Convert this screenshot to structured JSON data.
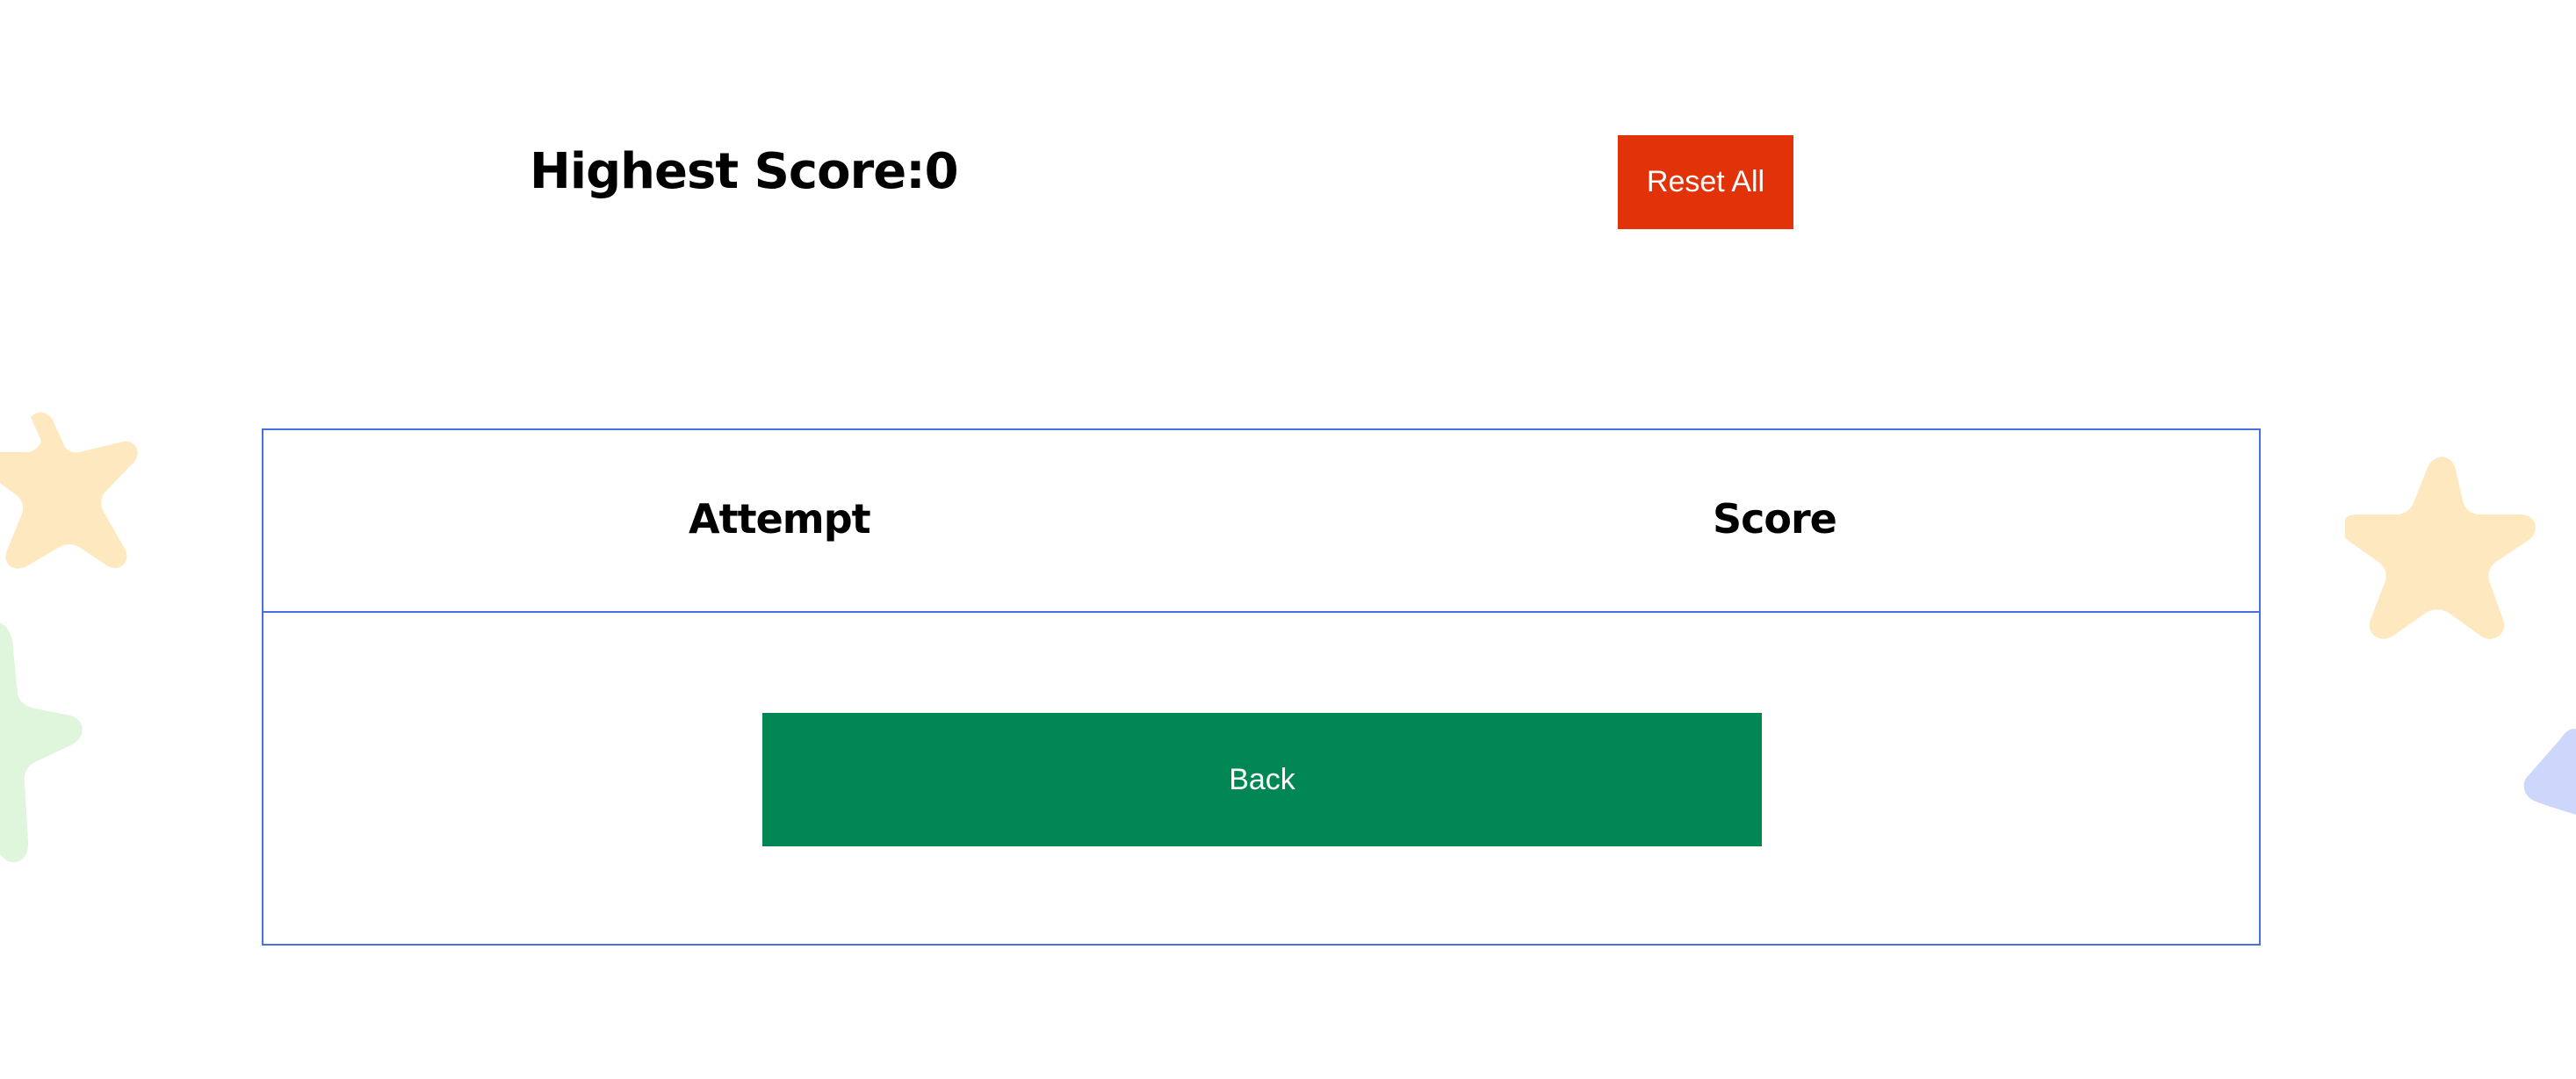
{
  "header": {
    "highest_score_label": "Highest Score:",
    "highest_score_value": "0",
    "reset_label": "Reset All"
  },
  "table": {
    "columns": [
      "Attempt",
      "Score"
    ],
    "rows": []
  },
  "actions": {
    "back_label": "Back"
  },
  "colors": {
    "reset_button": "#e13209",
    "back_button": "#018754",
    "table_border": "#4a6fe0",
    "star_yellow": "#fde8bf",
    "star_green": "#dff5dc",
    "star_blue": "#cdd6fb"
  },
  "decorations": [
    "star-yellow-icon",
    "star-green-icon",
    "star-yellow-icon",
    "star-blue-icon"
  ]
}
